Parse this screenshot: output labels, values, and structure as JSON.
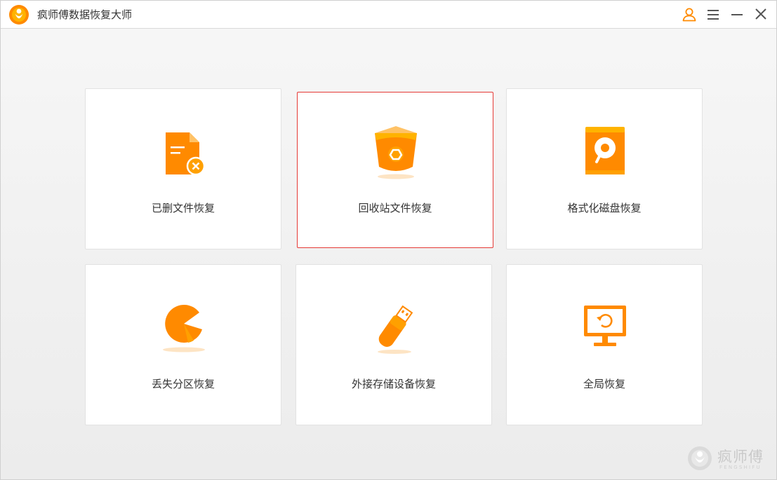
{
  "window": {
    "title": "疯师傅数据恢复大师"
  },
  "titlebar_controls": [
    {
      "name": "user-button",
      "icon": "user-icon"
    },
    {
      "name": "menu-button",
      "icon": "hamburger-menu-icon"
    },
    {
      "name": "minimize-button",
      "icon": "minimize-icon"
    },
    {
      "name": "close-button",
      "icon": "close-icon"
    }
  ],
  "colors": {
    "accent": "#ff8a00",
    "accent_light": "#ffb300",
    "selected_border": "#e53935",
    "title_text": "#333333"
  },
  "cards": [
    {
      "label": "已删文件恢复",
      "icon": "deleted-file-icon",
      "selected": false
    },
    {
      "label": "回收站文件恢复",
      "icon": "recycle-bin-icon",
      "selected": true
    },
    {
      "label": "格式化磁盘恢复",
      "icon": "formatted-disk-icon",
      "selected": false
    },
    {
      "label": "丢失分区恢复",
      "icon": "lost-partition-icon",
      "selected": false
    },
    {
      "label": "外接存储设备恢复",
      "icon": "usb-drive-icon",
      "selected": false
    },
    {
      "label": "全局恢复",
      "icon": "monitor-restore-icon",
      "selected": false
    }
  ],
  "watermark": {
    "text": "疯师傅",
    "subtext": "FENGSHIFU"
  }
}
